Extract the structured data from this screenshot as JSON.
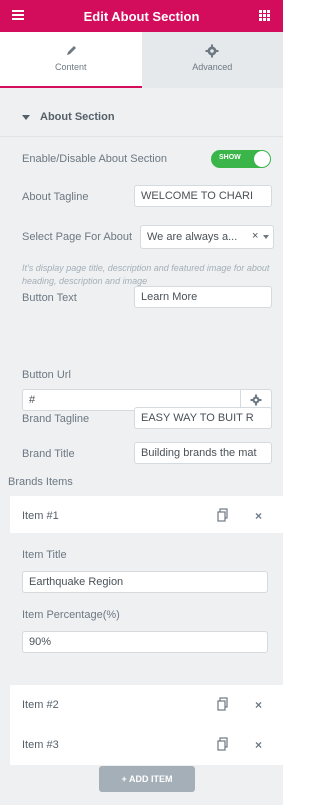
{
  "header": {
    "title": "Edit About Section",
    "menu_icon": "hamburger-icon",
    "apps_icon": "grid-icon",
    "accent": "#d30c5c"
  },
  "tabs": [
    {
      "label": "Content",
      "icon": "pencil-icon",
      "active": true
    },
    {
      "label": "Advanced",
      "icon": "gear-icon",
      "active": false
    }
  ],
  "section": {
    "title": "About Section"
  },
  "fields": {
    "enable": {
      "label": "Enable/Disable About Section",
      "toggle_text": "SHOW",
      "on": true
    },
    "tagline": {
      "label": "About Tagline",
      "value": "WELCOME TO CHARI"
    },
    "page": {
      "label": "Select Page For About",
      "value": "We are always a...",
      "clear": "×"
    },
    "page_hint": "It's display page title, description and featured image for about heading, description and image",
    "button_text": {
      "label": "Button Text",
      "value": "Learn More"
    },
    "button_url": {
      "label": "Button Url",
      "value": "#"
    },
    "brand_tagline": {
      "label": "Brand Tagline",
      "value": "EASY WAY TO BUIT R"
    },
    "brand_title": {
      "label": "Brand Title",
      "value": "Building brands the mat"
    }
  },
  "brands": {
    "label": "Brands Items",
    "items": [
      {
        "title": "Item #1"
      },
      {
        "title": "Item #2"
      },
      {
        "title": "Item #3"
      }
    ],
    "expanded": {
      "item_title_label": "Item Title",
      "item_title_value": "Earthquake Region",
      "percentage_label": "Item Percentage(%)",
      "percentage_value": "90%"
    },
    "delete_glyph": "×",
    "add_label": "+ ADD ITEM"
  },
  "colors": {
    "toggle_on": "#39b54a",
    "panel_bg": "#eef0f2",
    "button_bg": "#a4afb7"
  }
}
